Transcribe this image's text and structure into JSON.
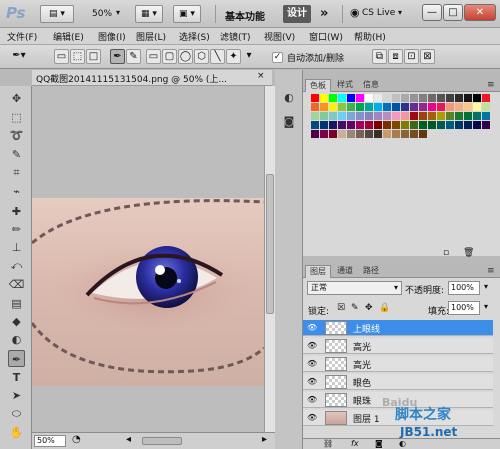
{
  "app": {
    "logo": "Ps",
    "zoom": "50%",
    "workspace_basic": "基本功能",
    "workspace_design": "设计",
    "more": "»",
    "cs_live": "CS Live",
    "win_min": "—",
    "win_max": "□",
    "win_close": "✕"
  },
  "menu": [
    "文件(F)",
    "编辑(E)",
    "图像(I)",
    "图层(L)",
    "选择(S)",
    "滤镜(T)",
    "视图(V)",
    "窗口(W)",
    "帮助(H)"
  ],
  "options": {
    "auto_add_delete": "自动添加/删除"
  },
  "document": {
    "title": "QQ截图20141115131504.png @ 50% (上...",
    "close": "×",
    "zoom_field": "50%"
  },
  "swatches": {
    "tabs": [
      "色板",
      "样式",
      "信息"
    ],
    "colors": [
      "#ff0000",
      "#ffff00",
      "#00ff00",
      "#00ffff",
      "#0000ff",
      "#ff00ff",
      "#ffffff",
      "#eaeaea",
      "#d5d5d5",
      "#c0c0c0",
      "#aaaaaa",
      "#959595",
      "#808080",
      "#6b6b6b",
      "#555555",
      "#404040",
      "#2b2b2b",
      "#151515",
      "#000000",
      "#ed1c24",
      "#f26522",
      "#f7941d",
      "#fff200",
      "#8dc63f",
      "#39b54a",
      "#00a651",
      "#00a99d",
      "#00aeef",
      "#0072bc",
      "#0054a6",
      "#2e3192",
      "#662d91",
      "#92278f",
      "#ec008c",
      "#ed145b",
      "#f69679",
      "#f9ad81",
      "#fdc689",
      "#fff799",
      "#c4df9b",
      "#a3d39c",
      "#82ca9c",
      "#7accc8",
      "#6dcff6",
      "#7da7d9",
      "#8393ca",
      "#8781bd",
      "#a186be",
      "#bd8cbf",
      "#f49ac1",
      "#f5989d",
      "#9e0b0f",
      "#a0410d",
      "#a3620a",
      "#aba000",
      "#598527",
      "#197b30",
      "#007236",
      "#00746b",
      "#0076a3",
      "#004a80",
      "#003471",
      "#1b1464",
      "#440e62",
      "#630460",
      "#9e005d",
      "#9e0039",
      "#790000",
      "#7b2e00",
      "#7d4900",
      "#827b00",
      "#406618",
      "#005e20",
      "#005826",
      "#005952",
      "#005b7f",
      "#003663",
      "#002157",
      "#0d004c",
      "#32004b",
      "#4b0049",
      "#7b0046",
      "#7a0026",
      "#c7b299",
      "#998675",
      "#736357",
      "#534741",
      "#37302a",
      "#c69c6d",
      "#a67c52",
      "#8c6239",
      "#754c24",
      "#603913"
    ]
  },
  "layers": {
    "tabs": [
      "图层",
      "通道",
      "路径"
    ],
    "blend_mode": "正常",
    "opacity_label": "不透明度:",
    "opacity": "100%",
    "lock_label": "锁定:",
    "fill_label": "填充:",
    "fill": "100%",
    "items": [
      {
        "name": "上眼线",
        "selected": true
      },
      {
        "name": "高光",
        "selected": false
      },
      {
        "name": "高光",
        "selected": false
      },
      {
        "name": "眼色",
        "selected": false
      },
      {
        "name": "眼珠",
        "selected": false
      },
      {
        "name": "图层 1",
        "selected": false
      }
    ]
  },
  "watermark": {
    "line1": "脚本之家",
    "line2": "JB51.net",
    "baidu": "Baidu"
  }
}
